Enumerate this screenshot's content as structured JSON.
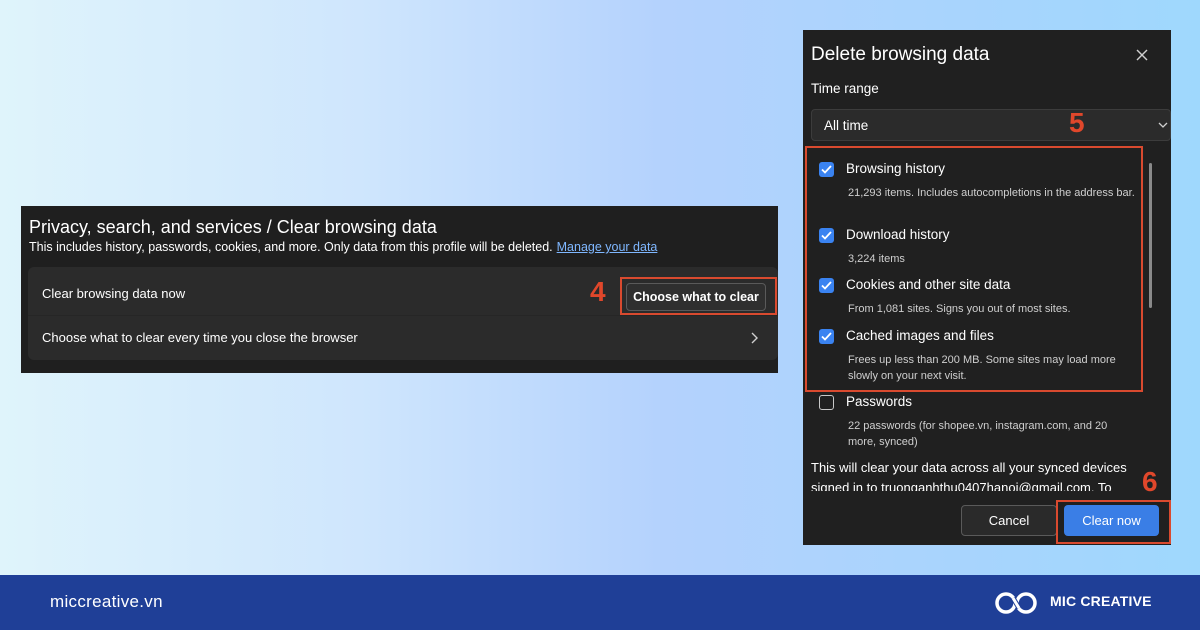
{
  "settings": {
    "title": "Privacy, search, and services / Clear browsing data",
    "description": "This includes history, passwords, cookies, and more. Only data from this profile will be deleted.",
    "manage_link": "Manage your data",
    "clear_now_label": "Clear browsing data now",
    "choose_button": "Choose what to clear",
    "every_time_label": "Choose what to clear every time you close the browser"
  },
  "steps": {
    "step4": "4",
    "step5": "5",
    "step6": "6"
  },
  "dialog": {
    "title": "Delete browsing data",
    "time_range_label": "Time range",
    "time_range_value": "All time",
    "items": [
      {
        "label": "Browsing history",
        "desc": "21,293 items. Includes autocompletions in the address bar.",
        "checked": true
      },
      {
        "label": "Download history",
        "desc": "3,224 items",
        "checked": true
      },
      {
        "label": "Cookies and other site data",
        "desc": "From 1,081 sites. Signs you out of most sites.",
        "checked": true
      },
      {
        "label": "Cached images and files",
        "desc": "Frees up less than 200 MB. Some sites may load more slowly on your next visit.",
        "checked": true
      },
      {
        "label": "Passwords",
        "desc": "22 passwords (for shopee.vn, instagram.com, and 20 more, synced)",
        "checked": false
      }
    ],
    "sync_note": "This will clear your data across all your synced devices signed in to truonganhthu0407hanoi@gmail.com. To",
    "cancel_label": "Cancel",
    "clear_label": "Clear now"
  },
  "footer": {
    "site_url": "miccreative.vn",
    "brand_name": "MIC CREATIVE"
  },
  "colors": {
    "accent_blue": "#3a83f1",
    "highlight_red": "#d94a2f",
    "footer_navy": "#1f3f97"
  }
}
